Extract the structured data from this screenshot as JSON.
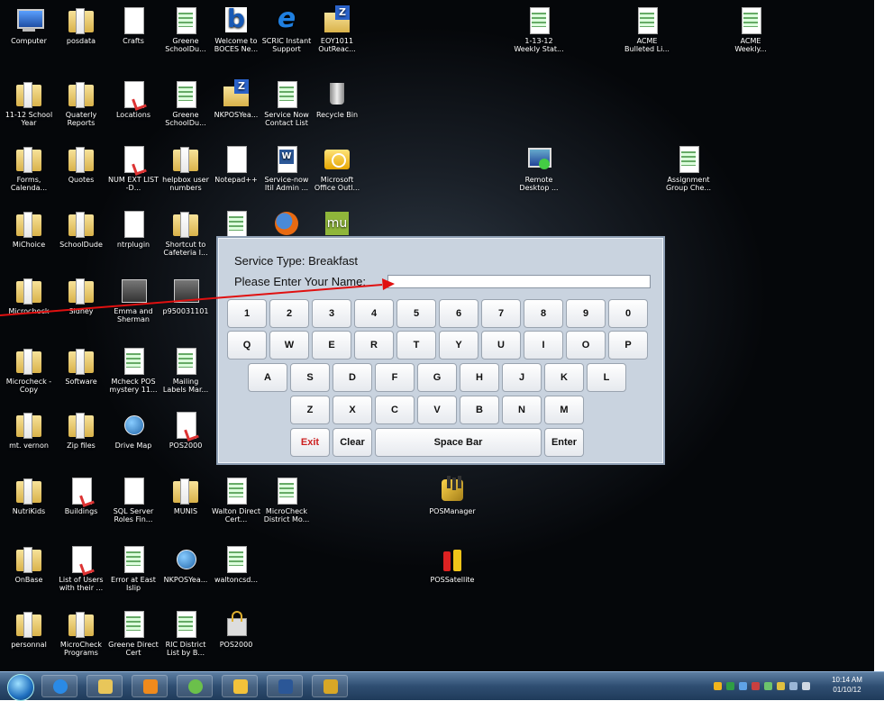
{
  "desktop_icons": [
    {
      "label": "Computer",
      "icon": "computer-icon"
    },
    {
      "label": "posdata",
      "icon": "folder-icon"
    },
    {
      "label": "Crafts",
      "icon": "document-icon"
    },
    {
      "label": "Greene SchoolDu...",
      "icon": "spreadsheet-icon"
    },
    {
      "label": "Welcome to BOCES Ne...",
      "icon": "web-b-icon"
    },
    {
      "label": "SCRIC Instant Support",
      "icon": "internet-explorer-icon"
    },
    {
      "label": "EOY1011 OutReac...",
      "icon": "z-folder-icon"
    },
    {
      "label": "1-13-12 Weekly Stat...",
      "icon": "spreadsheet-icon"
    },
    {
      "label": "ACME Bulleted Li...",
      "icon": "spreadsheet-icon"
    },
    {
      "label": "ACME Weekly...",
      "icon": "spreadsheet-icon"
    },
    {
      "label": "11-12 School Year",
      "icon": "folder-icon"
    },
    {
      "label": "Quaterly Reports",
      "icon": "folder-icon"
    },
    {
      "label": "Locations",
      "icon": "pdf-icon"
    },
    {
      "label": "Greene SchoolDu...",
      "icon": "spreadsheet-icon"
    },
    {
      "label": "NKPOSYea...",
      "icon": "z-folder-icon"
    },
    {
      "label": "Service Now Contact List",
      "icon": "spreadsheet-icon"
    },
    {
      "label": "Recycle Bin",
      "icon": "recycle-bin-icon"
    },
    {
      "label": "Forms, Calenda...",
      "icon": "folder-icon"
    },
    {
      "label": "Quotes",
      "icon": "folder-icon"
    },
    {
      "label": "NUM EXT LIST -D...",
      "icon": "pdf-icon"
    },
    {
      "label": "helpbox user numbers",
      "icon": "folder-icon"
    },
    {
      "label": "Notepad++",
      "icon": "notepad-icon"
    },
    {
      "label": "Service-now Itil Admin ...",
      "icon": "word-icon"
    },
    {
      "label": "Microsoft Office Outl...",
      "icon": "outlook-icon"
    },
    {
      "label": "Remote Desktop ...",
      "icon": "remote-desktop-icon"
    },
    {
      "label": "Assignment Group Che...",
      "icon": "spreadsheet-icon"
    },
    {
      "label": "MiChoice",
      "icon": "folder-icon"
    },
    {
      "label": "SchoolDude",
      "icon": "folder-icon"
    },
    {
      "label": "ntrplugin",
      "icon": "document-icon"
    },
    {
      "label": "Shortcut to Cafeteria I...",
      "icon": "folder-icon"
    },
    {
      "label": "Microcheck",
      "icon": "folder-icon"
    },
    {
      "label": "Sidney",
      "icon": "folder-icon"
    },
    {
      "label": "Emma and Sherman",
      "icon": "photo-icon"
    },
    {
      "label": "p950031101",
      "icon": "photo-icon"
    },
    {
      "label": "Microcheck - Copy",
      "icon": "folder-icon"
    },
    {
      "label": "Software",
      "icon": "folder-icon"
    },
    {
      "label": "Mcheck POS mystery 11...",
      "icon": "spreadsheet-icon"
    },
    {
      "label": "Mailing Labels Mar...",
      "icon": "spreadsheet-icon"
    },
    {
      "label": "mt. vernon",
      "icon": "folder-icon"
    },
    {
      "label": "Zip files",
      "icon": "folder-icon"
    },
    {
      "label": "Drive Map",
      "icon": "globe-icon"
    },
    {
      "label": "POS2000",
      "icon": "document-icon"
    },
    {
      "label": "NutriKids",
      "icon": "folder-icon"
    },
    {
      "label": "Buildings",
      "icon": "pdf-icon"
    },
    {
      "label": "SQL Server Roles Fin...",
      "icon": "document-icon"
    },
    {
      "label": "MUNIS",
      "icon": "folder-icon"
    },
    {
      "label": "Walton Direct Cert...",
      "icon": "spreadsheet-icon"
    },
    {
      "label": "MicroCheck District Mo...",
      "icon": "spreadsheet-icon"
    },
    {
      "label": "POSManager",
      "icon": "pos-manager-icon"
    },
    {
      "label": "OnBase",
      "icon": "folder-icon"
    },
    {
      "label": "List of Users with their ...",
      "icon": "pdf-icon"
    },
    {
      "label": "Error at East Islip",
      "icon": "spreadsheet-icon"
    },
    {
      "label": "NKPOSYea...",
      "icon": "globe-icon"
    },
    {
      "label": "waltoncsd...",
      "icon": "spreadsheet-icon"
    },
    {
      "label": "POSSatellite",
      "icon": "pos-satellite-icon"
    },
    {
      "label": "personnal",
      "icon": "folder-icon"
    },
    {
      "label": "MicroCheck Programs",
      "icon": "folder-icon"
    },
    {
      "label": "Greene Direct Cert",
      "icon": "spreadsheet-icon"
    },
    {
      "label": "RIC District List by B...",
      "icon": "spreadsheet-icon"
    },
    {
      "label": "POS2000",
      "icon": "lock-icon"
    }
  ],
  "pos_dialog": {
    "service_type_text": "Service Type: Breakfast",
    "name_prompt": "Please Enter Your Name:",
    "name_value": "",
    "keys_row1": [
      "1",
      "2",
      "3",
      "4",
      "5",
      "6",
      "7",
      "8",
      "9",
      "0"
    ],
    "keys_row2": [
      "Q",
      "W",
      "E",
      "R",
      "T",
      "Y",
      "U",
      "I",
      "O",
      "P"
    ],
    "keys_row3": [
      "A",
      "S",
      "D",
      "F",
      "G",
      "H",
      "J",
      "K",
      "L"
    ],
    "keys_row4": [
      "Z",
      "X",
      "C",
      "V",
      "B",
      "N",
      "M"
    ],
    "exit_label": "Exit",
    "clear_label": "Clear",
    "space_label": "Space Bar",
    "enter_label": "Enter"
  },
  "annotation": {
    "arrow_color": "#e01010"
  },
  "taskbar": {
    "clock_time": "10:14 AM",
    "clock_date": "01/10/12",
    "pinned": [
      "internet-explorer-icon",
      "folder-explorer-icon",
      "outlook-icon",
      "people-icon",
      "outlook-icon",
      "word-icon",
      "pos-manager-icon"
    ]
  }
}
